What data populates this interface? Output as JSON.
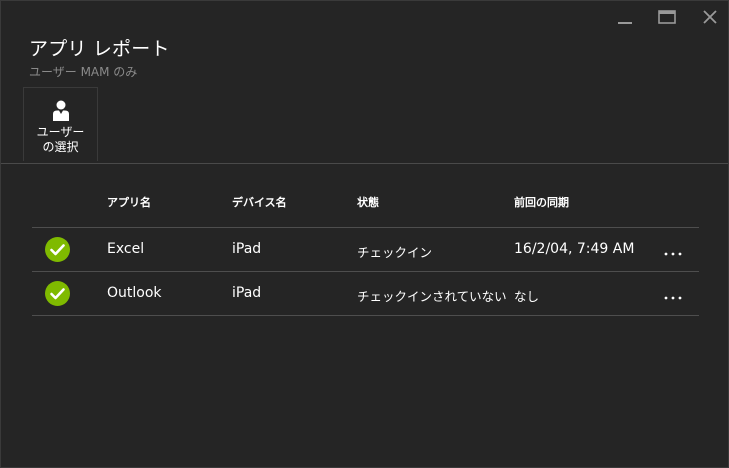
{
  "window": {
    "minimize_icon": "minimize-icon",
    "maximize_icon": "maximize-icon",
    "close_icon": "close-icon"
  },
  "header": {
    "title": "アプリ レポート",
    "subtitle": "ユーザー MAM のみ"
  },
  "command_bar": {
    "select_user": {
      "icon": "user-icon",
      "label_line1": "ユーザー",
      "label_line2": "の選択"
    }
  },
  "grid": {
    "columns": {
      "app_name": "アプリ名",
      "device_name": "デバイス名",
      "status": "状態",
      "last_sync": "前回の同期"
    },
    "rows": [
      {
        "status_icon": "check-circle-icon",
        "app_name": "Excel",
        "device_name": "iPad",
        "status": "チェックイン",
        "last_sync": "16/2/04, 7:49 AM",
        "more": "…"
      },
      {
        "status_icon": "check-circle-icon",
        "app_name": "Outlook",
        "device_name": "iPad",
        "status": "チェックインされていない",
        "last_sync": "なし",
        "more": "…"
      }
    ]
  },
  "colors": {
    "background": "#252525",
    "status_ok": "#7fba00",
    "muted_text": "#8a8a8a",
    "divider": "#4e4e4e"
  }
}
